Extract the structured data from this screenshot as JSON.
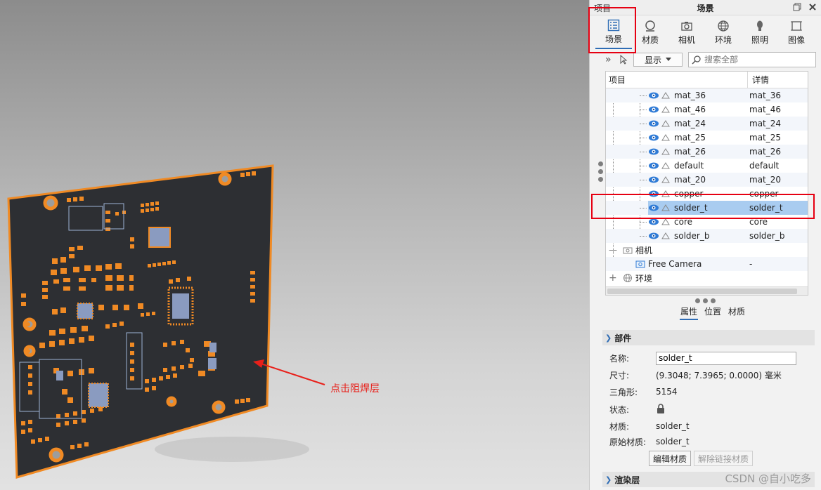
{
  "annotation": {
    "text": "点击阻焊层",
    "color": "#e8201a"
  },
  "panel": {
    "left_title": "项目",
    "title": "场景",
    "tabs": [
      {
        "label": "场景",
        "icon": "scene-tree-icon",
        "active": true
      },
      {
        "label": "材质",
        "icon": "material-icon"
      },
      {
        "label": "相机",
        "icon": "camera-icon"
      },
      {
        "label": "环境",
        "icon": "environment-globe-icon"
      },
      {
        "label": "照明",
        "icon": "light-bulb-icon"
      },
      {
        "label": "图像",
        "icon": "image-icon"
      }
    ],
    "toolbar": {
      "show_label": "显示",
      "search_placeholder": "搜索全部"
    },
    "tree": {
      "col_item": "项目",
      "col_detail": "详情",
      "parts": [
        {
          "name": "mat_36",
          "detail": "mat_36"
        },
        {
          "name": "mat_46",
          "detail": "mat_46"
        },
        {
          "name": "mat_24",
          "detail": "mat_24"
        },
        {
          "name": "mat_25",
          "detail": "mat_25"
        },
        {
          "name": "mat_26",
          "detail": "mat_26"
        },
        {
          "name": "default",
          "detail": "default"
        },
        {
          "name": "mat_20",
          "detail": "mat_20"
        },
        {
          "name": "copper",
          "detail": "copper"
        },
        {
          "name": "solder_t",
          "detail": "solder_t",
          "selected": true
        },
        {
          "name": "core",
          "detail": "core"
        },
        {
          "name": "solder_b",
          "detail": "solder_b"
        }
      ],
      "camera_group": "相机",
      "camera_item": "Free Camera",
      "camera_detail": "-",
      "env_group": "环境"
    },
    "subtabs": [
      "属性",
      "位置",
      "材质"
    ],
    "props": {
      "section_title": "部件",
      "name_label": "名称:",
      "name_value": "solder_t",
      "size_label": "尺寸:",
      "size_value": "(9.3048; 7.3965; 0.0000) 毫米",
      "tri_label": "三角形:",
      "tri_value": "5154",
      "state_label": "状态:",
      "material_label": "材质:",
      "material_value": "solder_t",
      "orig_material_label": "原始材质:",
      "orig_material_value": "solder_t",
      "edit_material_btn": "编辑材质",
      "unlink_material_btn": "解除链接材质",
      "render_section_title": "渲染层"
    }
  },
  "watermark": "CSDN @自小吃多",
  "colors": {
    "accent": "#2f6db5",
    "highlight_box": "#e60012",
    "pcb_outline": "#f08a24",
    "pcb_board": "#2d2f33",
    "selection": "#a9ccf0"
  }
}
